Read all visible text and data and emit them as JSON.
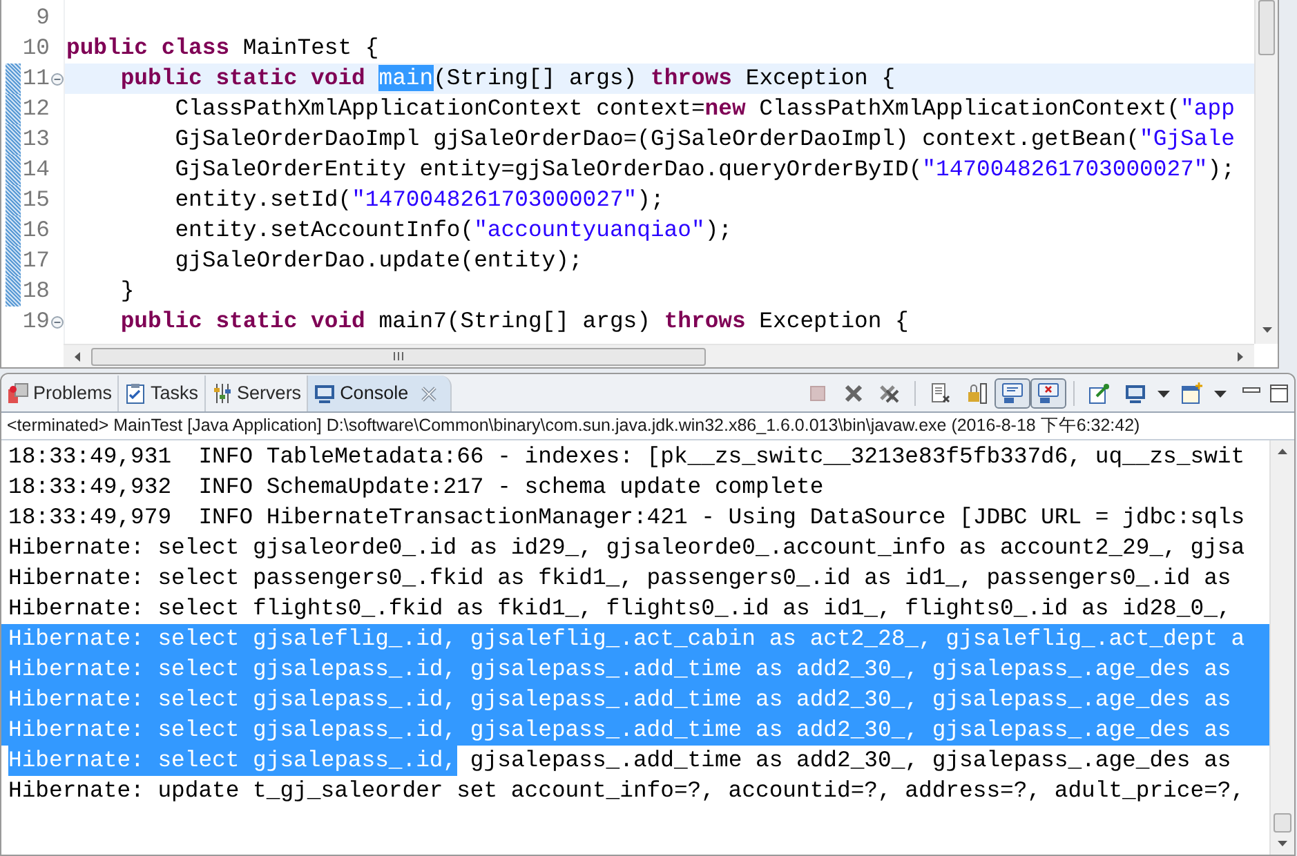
{
  "editor": {
    "lines": [
      {
        "number": "9",
        "current": false,
        "marked": false,
        "foldable": false
      },
      {
        "number": "10",
        "current": false,
        "marked": false,
        "foldable": false,
        "tokens": [
          {
            "kind": "keyword",
            "text": "public class"
          },
          {
            "kind": "plain",
            "text": " MainTest {"
          }
        ]
      },
      {
        "number": "11",
        "current": true,
        "marked": true,
        "foldable": true,
        "tokens": [
          {
            "kind": "keyword",
            "text": "    public static void "
          },
          {
            "kind": "occurrence",
            "text": "main"
          },
          {
            "kind": "plain",
            "text": "(String[] args) "
          },
          {
            "kind": "keyword",
            "text": "throws"
          },
          {
            "kind": "plain",
            "text": " Exception {"
          }
        ]
      },
      {
        "number": "12",
        "current": false,
        "marked": true,
        "foldable": false,
        "tokens": [
          {
            "kind": "plain",
            "text": "        ClassPathXmlApplicationContext context="
          },
          {
            "kind": "keyword",
            "text": "new"
          },
          {
            "kind": "plain",
            "text": " ClassPathXmlApplicationContext("
          },
          {
            "kind": "string",
            "text": "\"app"
          }
        ]
      },
      {
        "number": "13",
        "current": false,
        "marked": true,
        "foldable": false,
        "tokens": [
          {
            "kind": "plain",
            "text": "        GjSaleOrderDaoImpl gjSaleOrderDao=(GjSaleOrderDaoImpl) context.getBean("
          },
          {
            "kind": "string",
            "text": "\"GjSale"
          }
        ]
      },
      {
        "number": "14",
        "current": false,
        "marked": true,
        "foldable": false,
        "tokens": [
          {
            "kind": "plain",
            "text": "        GjSaleOrderEntity entity=gjSaleOrderDao.queryOrderByID("
          },
          {
            "kind": "string",
            "text": "\"1470048261703000027\""
          },
          {
            "kind": "plain",
            "text": ");"
          }
        ]
      },
      {
        "number": "15",
        "current": false,
        "marked": true,
        "foldable": false,
        "tokens": [
          {
            "kind": "plain",
            "text": "        entity.setId("
          },
          {
            "kind": "string",
            "text": "\"1470048261703000027\""
          },
          {
            "kind": "plain",
            "text": ");"
          }
        ]
      },
      {
        "number": "16",
        "current": false,
        "marked": true,
        "foldable": false,
        "tokens": [
          {
            "kind": "plain",
            "text": "        entity.setAccountInfo("
          },
          {
            "kind": "string",
            "text": "\"accountyuanqiao\""
          },
          {
            "kind": "plain",
            "text": ");"
          }
        ]
      },
      {
        "number": "17",
        "current": false,
        "marked": true,
        "foldable": false,
        "tokens": [
          {
            "kind": "plain",
            "text": "        gjSaleOrderDao.update(entity);"
          }
        ]
      },
      {
        "number": "18",
        "current": false,
        "marked": true,
        "foldable": false,
        "tokens": [
          {
            "kind": "plain",
            "text": "    }"
          }
        ]
      },
      {
        "number": "19",
        "current": false,
        "marked": false,
        "foldable": true,
        "tokens": [
          {
            "kind": "keyword",
            "text": "    public static void"
          },
          {
            "kind": "plain",
            "text": " main7(String[] args) "
          },
          {
            "kind": "keyword",
            "text": "throws"
          },
          {
            "kind": "plain",
            "text": " Exception {"
          }
        ]
      }
    ]
  },
  "tabs": [
    {
      "label": "Problems",
      "selected": false
    },
    {
      "label": "Tasks",
      "selected": false
    },
    {
      "label": "Servers",
      "selected": false
    },
    {
      "label": "Console",
      "selected": true
    }
  ],
  "toolbar": [
    {
      "kind": "button",
      "disabled": true
    },
    {
      "kind": "button",
      "disabled": false
    },
    {
      "kind": "button",
      "disabled": false
    },
    {
      "kind": "separator"
    },
    {
      "kind": "button",
      "disabled": false
    },
    {
      "kind": "toggle",
      "pressed": false
    },
    {
      "kind": "toggle",
      "pressed": true
    },
    {
      "kind": "toggle",
      "pressed": true
    },
    {
      "kind": "separator"
    },
    {
      "kind": "button",
      "disabled": false
    },
    {
      "kind": "button",
      "disabled": false
    },
    {
      "kind": "dropdown"
    },
    {
      "kind": "button",
      "disabled": false
    },
    {
      "kind": "dropdown"
    }
  ],
  "console": {
    "status": "<terminated> MainTest [Java Application] D:\\software\\Common\\binary\\com.sun.java.jdk.win32.x86_1.6.0.013\\bin\\javaw.exe (2016-8-18 下午6:32:42)",
    "lines": [
      [
        {
          "text": "18:33:49,931  INFO TableMetadata:66 - indexes: [pk__zs_switc__3213e83f5fb337d6, uq__zs_swit",
          "selected": false
        }
      ],
      [
        {
          "text": "18:33:49,932  INFO SchemaUpdate:217 - schema update complete",
          "selected": false
        }
      ],
      [
        {
          "text": "18:33:49,979  INFO HibernateTransactionManager:421 - Using DataSource [JDBC URL = jdbc:sqls",
          "selected": false
        }
      ],
      [
        {
          "text": "Hibernate: select gjsaleorde0_.id as id29_, gjsaleorde0_.account_info as account2_29_, gjsa",
          "selected": false
        }
      ],
      [
        {
          "text": "Hibernate: select passengers0_.fkid as fkid1_, passengers0_.id as id1_, passengers0_.id as",
          "selected": false
        }
      ],
      [
        {
          "text": "Hibernate: select flights0_.fkid as fkid1_, flights0_.id as id1_, flights0_.id as id28_0_,",
          "selected": false
        }
      ],
      [
        {
          "text": "Hibernate: select gjsaleflig_.id, gjsaleflig_.act_cabin as act2_28_, gjsaleflig_.act_dept a",
          "selected": true
        }
      ],
      [
        {
          "text": "Hibernate: select gjsalepass_.id, gjsalepass_.add_time as add2_30_, gjsalepass_.age_des as",
          "selected": true
        }
      ],
      [
        {
          "text": "Hibernate: select gjsalepass_.id, gjsalepass_.add_time as add2_30_, gjsalepass_.age_des as",
          "selected": true
        }
      ],
      [
        {
          "text": "Hibernate: select gjsalepass_.id, gjsalepass_.add_time as add2_30_, gjsalepass_.age_des as",
          "selected": true
        }
      ],
      [
        {
          "text": "Hibernate: select gjsalepass_.id,",
          "selected": true
        },
        {
          "text": " gjsalepass_.add_time as add2_30_, gjsalepass_.age_des as",
          "selected": false
        }
      ],
      [
        {
          "text": "Hibernate: update t_gj_saleorder set account_info=?, accountid=?, address=?, adult_price=?,",
          "selected": false
        }
      ]
    ]
  }
}
